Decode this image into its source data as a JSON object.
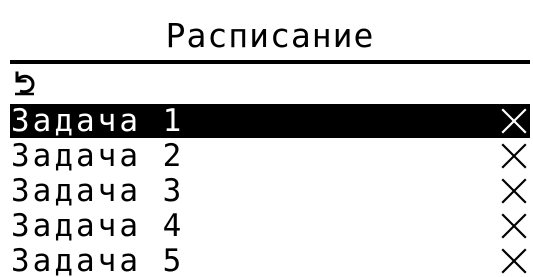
{
  "header": {
    "title": "Расписание"
  },
  "back": {
    "icon": "back-arrow-icon"
  },
  "tasks": [
    {
      "label": "Задача 1",
      "selected": true,
      "delete_icon": "close-icon"
    },
    {
      "label": "Задача 2",
      "selected": false,
      "delete_icon": "close-icon"
    },
    {
      "label": "Задача 3",
      "selected": false,
      "delete_icon": "close-icon"
    },
    {
      "label": "Задача 4",
      "selected": false,
      "delete_icon": "close-icon"
    },
    {
      "label": "Задача 5",
      "selected": false,
      "delete_icon": "close-icon"
    }
  ],
  "colors": {
    "foreground": "#000000",
    "background": "#ffffff",
    "selection_background": "#000000",
    "selection_foreground": "#ffffff"
  }
}
